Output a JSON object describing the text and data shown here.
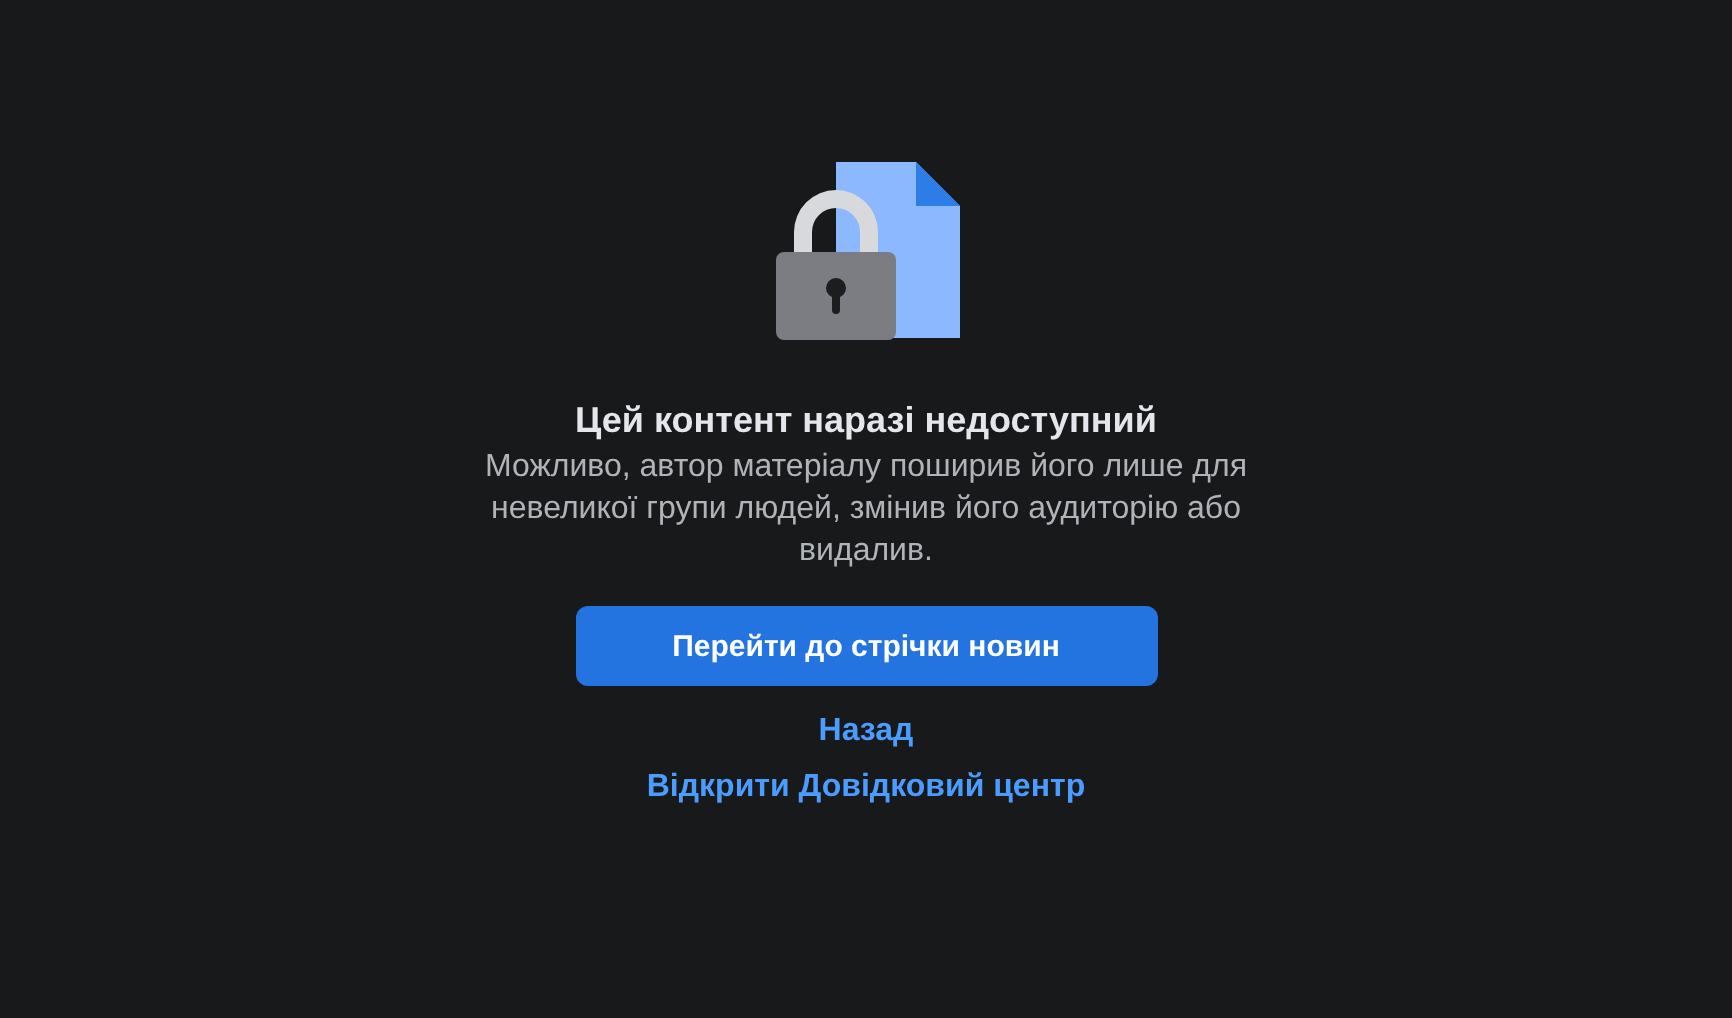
{
  "title": "Цей контент наразі недоступний",
  "message": "Можливо, автор матеріалу поширив його лише для невеликої групи людей, змінив його аудиторію або видалив.",
  "primary_button": "Перейти до стрічки новин",
  "links": [
    "Назад",
    "Відкрити Довідковий центр"
  ]
}
